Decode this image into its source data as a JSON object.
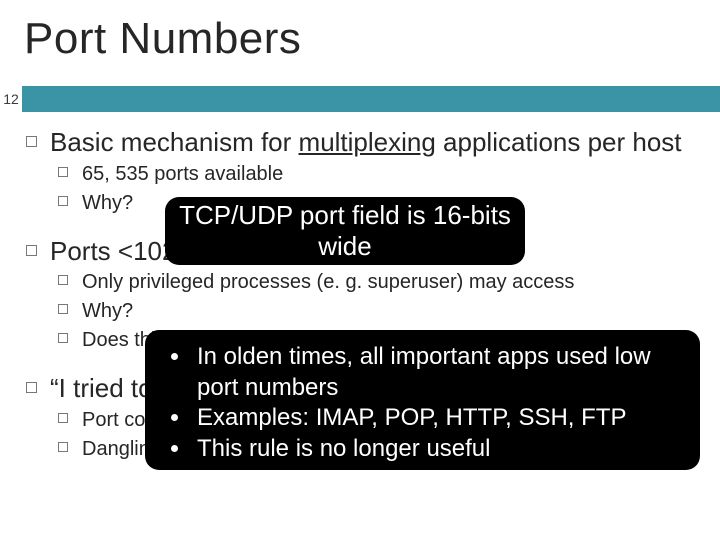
{
  "title": "Port Numbers",
  "page": "12",
  "bullets": {
    "b1": {
      "text_a": "Basic mechanism for ",
      "text_b": "multiplexing",
      "text_c": " applications per host"
    },
    "b1a": "65, 535 ports available",
    "b1b": "Why?",
    "b2": "Ports <1024 are ‘well-known’",
    "b2a": "Only privileged processes (e. g. superuser) may access",
    "b2b": "Why?",
    "b2c": "Does this cause security issues?",
    "b3": "“I tried to open a port and got an error”",
    "b3a": "Port collision: only one app per port per host",
    "b3b": "Dangling sockets"
  },
  "callout_top": "TCP/UDP port field is 16‑bits wide",
  "callout_bottom": {
    "li1": "In olden times, all important apps used low port numbers",
    "li2": "Examples: IMAP, POP, HTTP, SSH, FTP",
    "li3": "This rule is no longer useful"
  }
}
